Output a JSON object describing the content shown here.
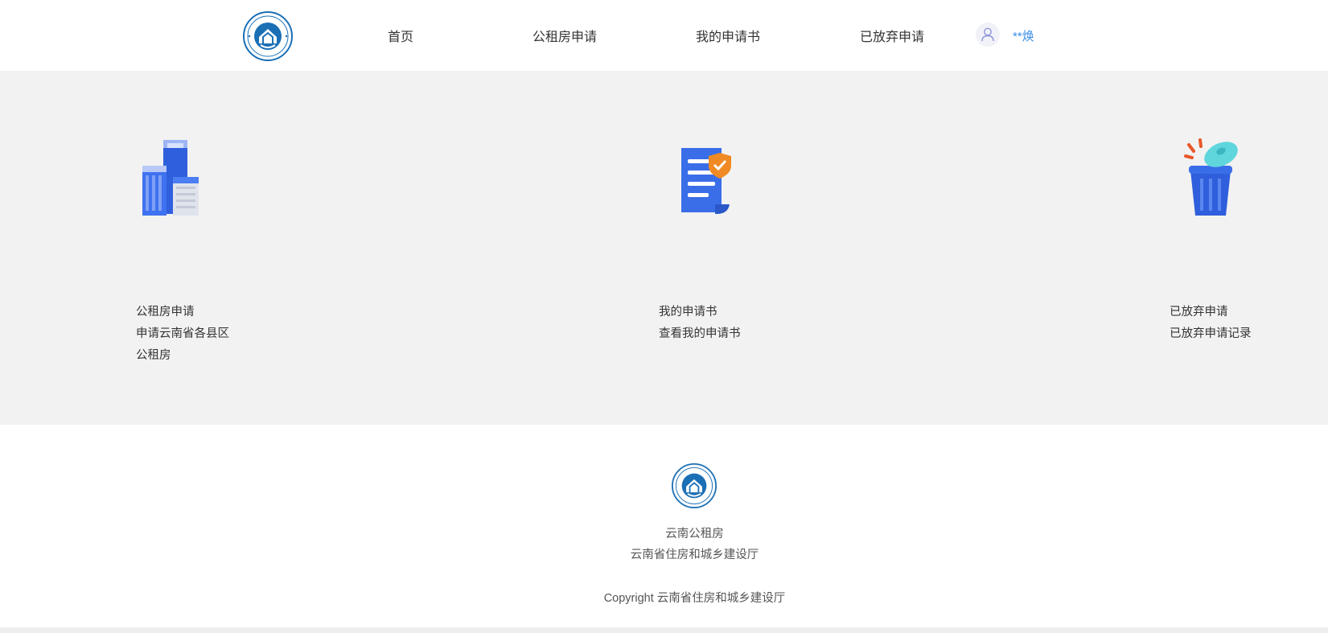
{
  "header": {
    "nav": [
      {
        "label": "首页"
      },
      {
        "label": "公租房申请"
      },
      {
        "label": "我的申请书"
      },
      {
        "label": "已放弃申请"
      }
    ],
    "username": "**焕",
    "avatar_icon": "user-icon"
  },
  "cards": [
    {
      "title": "公租房申请",
      "desc_line1": "申请云南省各县区",
      "desc_line2": "公租房",
      "icon": "building-icon"
    },
    {
      "title": "我的申请书",
      "desc_line1": "查看我的申请书",
      "icon": "document-shield-icon"
    },
    {
      "title": "已放弃申请",
      "desc_line1": "已放弃申请记录",
      "icon": "trash-bin-icon"
    }
  ],
  "footer": {
    "site_name": "云南公租房",
    "org": "云南省住房和城乡建设厅",
    "copyright": "Copyright 云南省住房和城乡建设厅"
  },
  "colors": {
    "accent": "#3b8ee6",
    "logo_blue": "#1a6fb5",
    "page_bg": "#f2f2f2"
  }
}
